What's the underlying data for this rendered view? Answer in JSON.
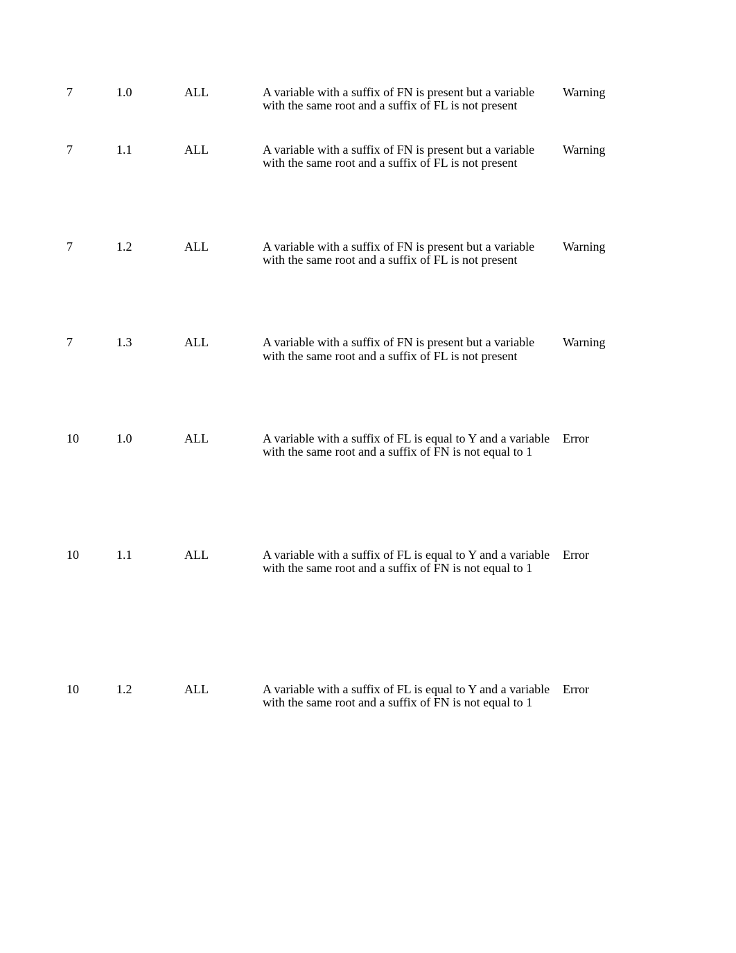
{
  "rows": [
    {
      "id": "7",
      "version": "1.0",
      "scope": "ALL",
      "desc_line1": "A variable with a suffix of FN is present but a variable",
      "desc_line2": "with the same root and a suffix of FL is not present",
      "severity": "Warning"
    },
    {
      "id": "7",
      "version": "1.1",
      "scope": "ALL",
      "desc_line1": "A variable with a suffix of FN is present but a variable",
      "desc_line2": "with the same root and a suffix of FL is not present",
      "severity": "Warning"
    },
    {
      "id": "7",
      "version": "1.2",
      "scope": "ALL",
      "desc_line1": "A variable with a suffix of FN is present but a variable",
      "desc_line2": "with the same root and a suffix of FL is not present",
      "severity": "Warning"
    },
    {
      "id": "7",
      "version": "1.3",
      "scope": "ALL",
      "desc_line1": "A variable with a suffix of FN is present but a variable",
      "desc_line2": "with the same root and a suffix of FL is not present",
      "severity": "Warning"
    },
    {
      "id": "10",
      "version": "1.0",
      "scope": "ALL",
      "desc_line1": "A variable with a suffix of FL is equal to Y and a variable",
      "desc_line2": "with the same root and a suffix of FN is not equal to 1",
      "severity": "Error"
    },
    {
      "id": "10",
      "version": "1.1",
      "scope": "ALL",
      "desc_line1": "A variable with a suffix of FL is equal to Y and a variable",
      "desc_line2": "with the same root and a suffix of FN is not equal to 1",
      "severity": "Error"
    },
    {
      "id": "10",
      "version": "1.2",
      "scope": "ALL",
      "desc_line1": "A variable with a suffix of FL is equal to Y and a variable",
      "desc_line2": "with the same root and a suffix of FN is not equal to 1",
      "severity": "Error"
    }
  ]
}
